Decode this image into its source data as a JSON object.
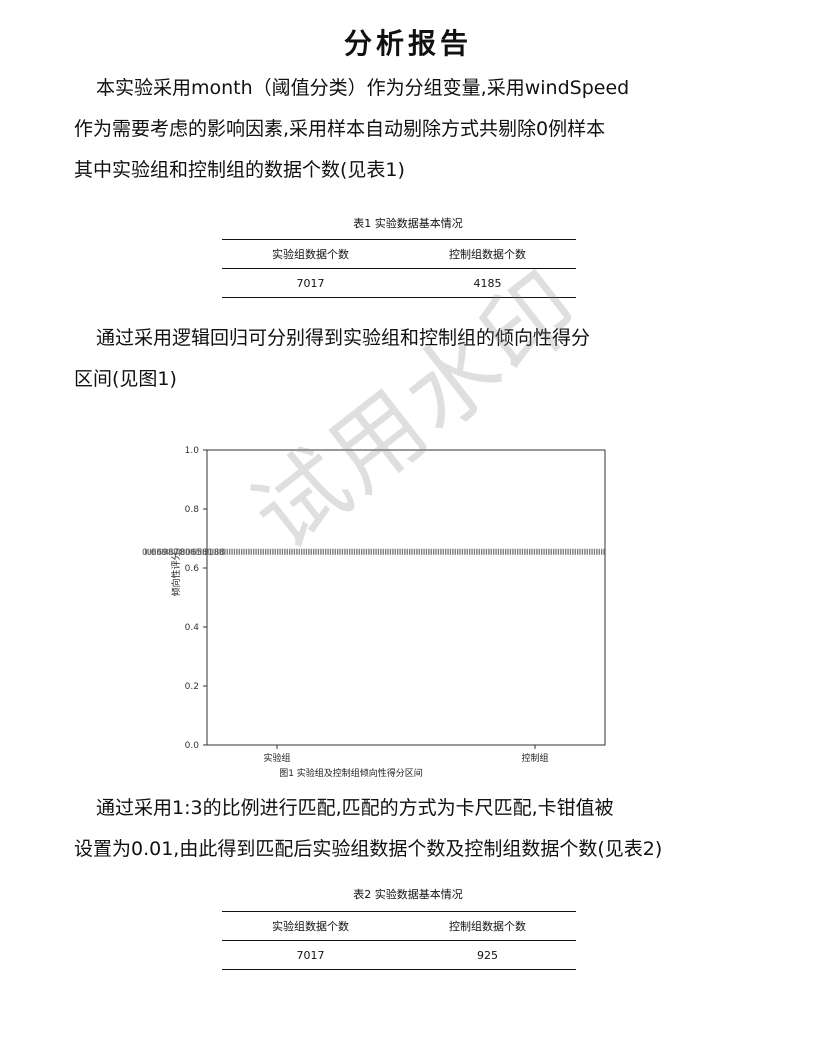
{
  "title": "分析报告",
  "para1": {
    "line1": "本实验采用month（阈值分类）作为分组变量,采用windSpeed",
    "line2": "作为需要考虑的影响因素,采用样本自动剔除方式共剔除0例样本",
    "line3": "其中实验组和控制组的数据个数(见表1)"
  },
  "table1": {
    "caption": "表1 实验数据基本情况",
    "headers": [
      "实验组数据个数",
      "控制组数据个数"
    ],
    "row": [
      "7017",
      "4185"
    ]
  },
  "para2": {
    "line1": "通过采用逻辑回归可分别得到实验组和控制组的倾向性得分",
    "line2": "区间(见图1)"
  },
  "chart_data": {
    "type": "scatter",
    "title": "",
    "caption": "图1 实验组及控制组倾向性得分区间",
    "xlabel": "",
    "ylabel": "倾向性评分",
    "categories": [
      "实验组",
      "控制组"
    ],
    "yticks": [
      "0.0",
      "0.2",
      "0.4",
      "0.6",
      "0.8",
      "1.0"
    ],
    "ylim": [
      0,
      1
    ],
    "band_value": 0.655,
    "overlap_label": "0.6698780658188",
    "series": [
      {
        "values": [
          0.655,
          0.655
        ]
      }
    ],
    "grid": false,
    "legend": "none"
  },
  "para3": {
    "line1": "通过采用1:3的比例进行匹配,匹配的方式为卡尺匹配,卡钳值被",
    "line2": "设置为0.01,由此得到匹配后实验组数据个数及控制组数据个数(见表2)"
  },
  "table2": {
    "caption": "表2 实验数据基本情况",
    "headers": [
      "实验组数据个数",
      "控制组数据个数"
    ],
    "row": [
      "7017",
      "925"
    ]
  },
  "watermark": "试用水印"
}
